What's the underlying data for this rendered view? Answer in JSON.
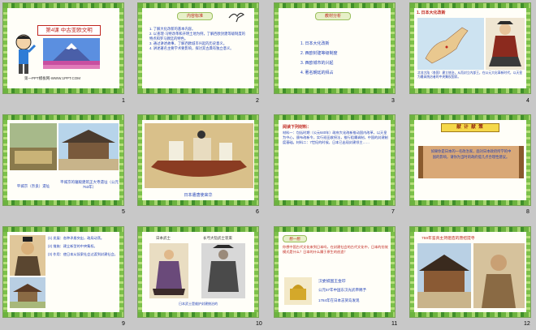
{
  "slides": [
    {
      "num": "1",
      "title": "第4课 中古亚欧文明",
      "site": "第一PPT模板网-WWW.1PPT.COM"
    },
    {
      "num": "2",
      "banner": "内容标准",
      "items": [
        "1. 了解大化改新的基本内容。",
        "2. 以查理·马特改革和开明土地为例，了解西欧封建等级制度的特点和罗马教廷的特色。",
        "3. 通过讲述故事，了解西欧城市兴起的历史意义。",
        "4. 讲述著名主要学术要影响，探讨其古典有独立意义。"
      ]
    },
    {
      "num": "3",
      "banner": "教材分析",
      "items": [
        "1. 日本大化改新",
        "2. 西欧封建等级制度",
        "3. 西欧城市的兴起",
        "4. 著名朝廷的拜占"
      ]
    },
    {
      "num": "4",
      "heading": "1. 日本大化改新",
      "caption": "北非大陆（各国）建立统治，从而封立内部王，在公元大化革新时代，以天皇为最高统治者的中央集权国家。"
    },
    {
      "num": "5",
      "cap_left": "平城京（奈良）遗址",
      "cap_right": "平城京的寝殿建筑正大寺遗址（公元763年）"
    },
    {
      "num": "6",
      "caption": "日本遣唐使来华"
    },
    {
      "num": "7",
      "heading": "阅读下列材料：",
      "body": "材料一：包括时期（公元640年）政府大化改新推动国内改革，以天皇为中心，颁布改新令，实行班田收授法，推行租庸调制，中国的封建制度基础。材料二：7世纪的时候，日本已出现封建领主……"
    },
    {
      "num": "8",
      "banner": "献 计 献 策",
      "scroll_text": "如果你是日本的一名政治家，面对日本政府所学的中国的影响，请你为当时的政府提几点合理性建议。"
    },
    {
      "num": "9",
      "items": [
        "(1) 发展：各种矛盾突出，政局动荡。",
        "(2) 措施：建立新型的中央集权。",
        "(3) 作用：使日本从奴隶社会过渡到封建社会。"
      ]
    },
    {
      "num": "10",
      "label_left": "日本武士",
      "label_right": "长弓大铠武士装束",
      "caption": "日本武士是维护封建统治的"
    },
    {
      "num": "11",
      "banner": "想一想",
      "question": "你想中国古代文化来到日本吗，在封建社会的古代文化中，日本的仿效模式是什么？日本的什么属于原生的创造？",
      "line1": "汉委奴国王金印",
      "line2": "公元57年中国东汉光武帝赐予",
      "line3": "1784年在日本志贺岛发现"
    },
    {
      "num": "12",
      "heading": "759年鉴真主持建造的唐招提寺"
    }
  ]
}
